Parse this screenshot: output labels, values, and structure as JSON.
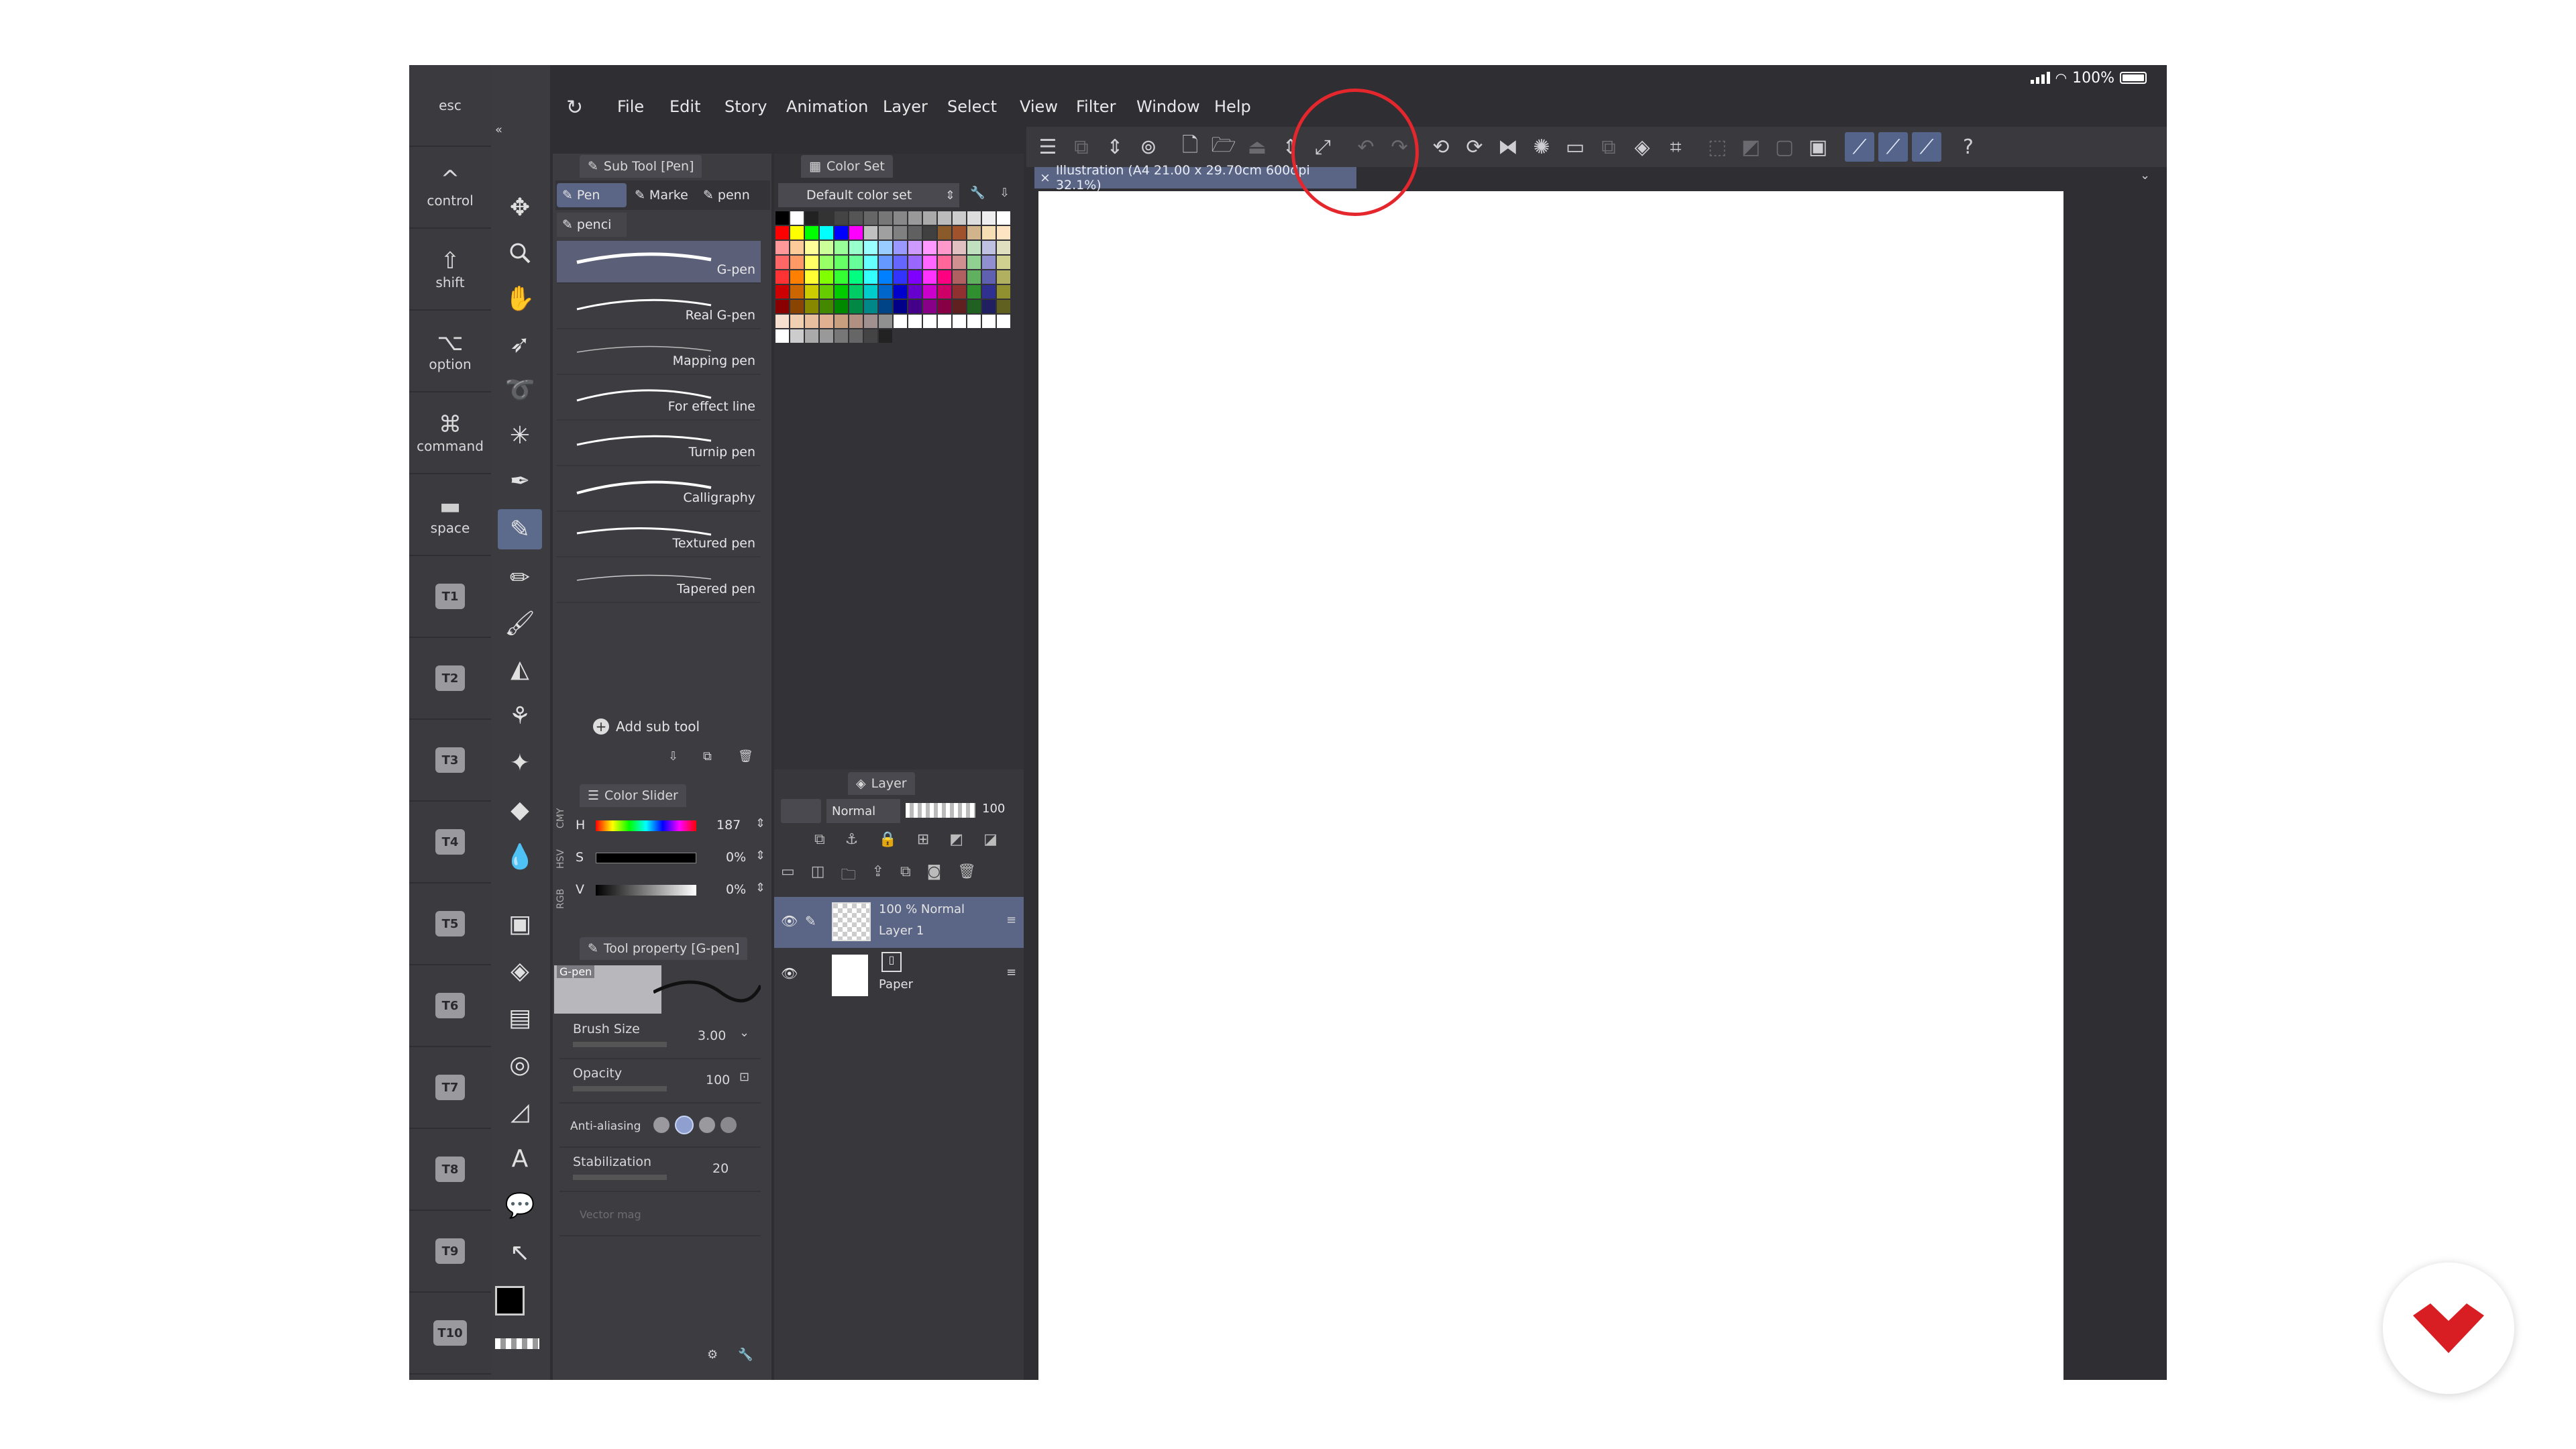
{
  "status": {
    "battery": "100%"
  },
  "modifiers": [
    {
      "label": "esc",
      "glyph": ""
    },
    {
      "label": "control",
      "glyph": "^"
    },
    {
      "label": "shift",
      "glyph": "⇧"
    },
    {
      "label": "option",
      "glyph": "⌥"
    },
    {
      "label": "command",
      "glyph": "⌘"
    },
    {
      "label": "space",
      "glyph": "▬"
    }
  ],
  "tkeys": [
    "T1",
    "T2",
    "T3",
    "T4",
    "T5",
    "T6",
    "T7",
    "T8",
    "T9",
    "T10"
  ],
  "menu": [
    "File",
    "Edit",
    "Story",
    "Animation",
    "Layer",
    "Select",
    "View",
    "Filter",
    "Window",
    "Help"
  ],
  "subtool": {
    "title": "Sub Tool [Pen]",
    "tabs": [
      "Pen",
      "Marke",
      "penn",
      "penci"
    ],
    "brushes": [
      "G-pen",
      "Real G-pen",
      "Mapping pen",
      "For effect line",
      "Turnip pen",
      "Calligraphy",
      "Textured pen",
      "Tapered pen"
    ],
    "add_label": "Add sub tool"
  },
  "color_set": {
    "title": "Color Set",
    "dropdown": "Default color set"
  },
  "color_slider": {
    "title": "Color Slider",
    "mode_tabs": [
      "RGB",
      "HSV",
      "CMY"
    ],
    "rows": [
      {
        "label": "H",
        "value": "187"
      },
      {
        "label": "S",
        "value": "0%"
      },
      {
        "label": "V",
        "value": "0%"
      }
    ]
  },
  "tool_property": {
    "title": "Tool property [G-pen]",
    "preset_label": "G-pen",
    "brush_size_label": "Brush Size",
    "brush_size_value": "3.00",
    "opacity_label": "Opacity",
    "opacity_value": "100",
    "antialias_label": "Anti-aliasing",
    "stabilization_label": "Stabilization",
    "stabilization_value": "20",
    "vector_label": "Vector mag"
  },
  "layer_panel": {
    "title": "Layer",
    "blend": "Normal",
    "opacity": "100",
    "layers": [
      {
        "line1": "100 % Normal",
        "line2": "Layer 1"
      },
      {
        "line1": "",
        "line2": "Paper"
      }
    ]
  },
  "document_tab": "Illustration (A4 21.00 x 29.70cm 600dpi 32.1%)",
  "colors": {
    "accent": "#5b6586",
    "highlight_circle": "#e3272d",
    "logo": "#d81e23"
  }
}
